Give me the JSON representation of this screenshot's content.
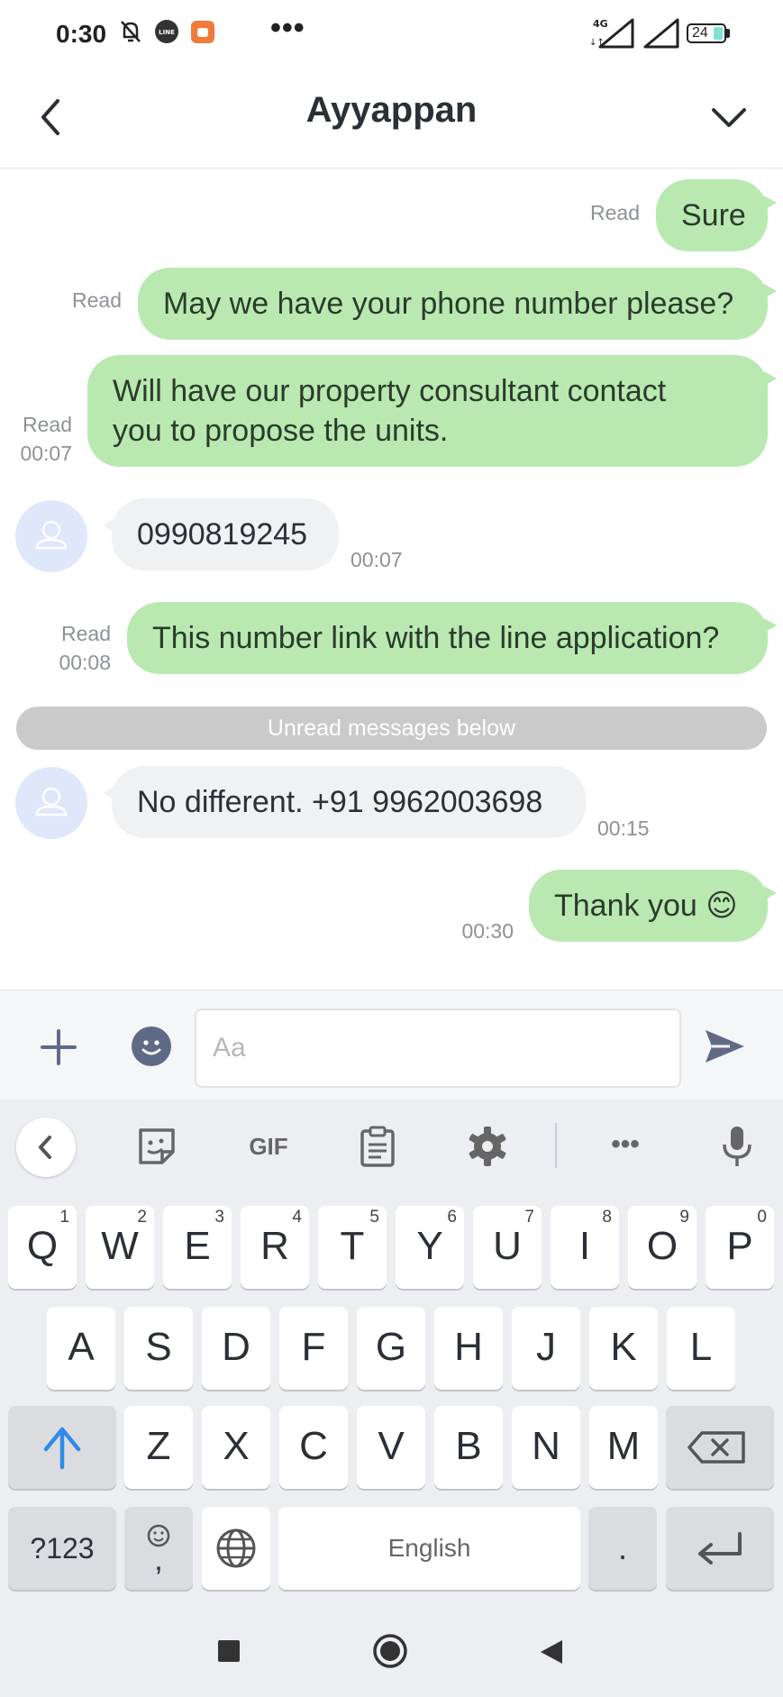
{
  "status_bar": {
    "time": "0:30",
    "network": "4G",
    "battery": "24",
    "more": "•••"
  },
  "header": {
    "title": "Ayyappan"
  },
  "messages": [
    {
      "dir": "out",
      "text": "Sure",
      "status": "Read",
      "time": ""
    },
    {
      "dir": "out",
      "text": "May we have your phone number please?",
      "status": "Read",
      "time": ""
    },
    {
      "dir": "out",
      "line1": "Will have our property consultant contact",
      "line2": "you to propose the units.",
      "status": "Read",
      "time": "00:07"
    },
    {
      "dir": "in",
      "text": "0990819245",
      "time": "00:07"
    },
    {
      "dir": "out",
      "text": "This number link with the line application?",
      "status": "Read",
      "time": "00:08"
    },
    {
      "dir": "in",
      "text": "No different. +91 9962003698",
      "time": "00:15"
    },
    {
      "dir": "out",
      "text": "Thank you 😊",
      "status": "",
      "time": "00:30"
    }
  ],
  "unread_divider": "Unread messages below",
  "composer": {
    "placeholder": "Aa"
  },
  "keyboard": {
    "toolbar": [
      "back-icon",
      "sticker-icon",
      "GIF",
      "clipboard-icon",
      "gear-icon",
      "more-icon",
      "mic-icon"
    ],
    "gif_label": "GIF",
    "more_label": "•••",
    "row1": [
      "Q",
      "W",
      "E",
      "R",
      "T",
      "Y",
      "U",
      "I",
      "O",
      "P"
    ],
    "row1_hints": [
      "1",
      "2",
      "3",
      "4",
      "5",
      "6",
      "7",
      "8",
      "9",
      "0"
    ],
    "row2": [
      "A",
      "S",
      "D",
      "F",
      "G",
      "H",
      "J",
      "K",
      "L"
    ],
    "row3": [
      "Z",
      "X",
      "C",
      "V",
      "B",
      "N",
      "M"
    ],
    "symbols": "?123",
    "comma": ",",
    "space": "English",
    "period": "."
  },
  "colors": {
    "outgoing_bubble": "#b9e9b1",
    "incoming_bubble": "#f0f1f3",
    "divider": "#cacaca",
    "shift_accent": "#2e8be8"
  }
}
